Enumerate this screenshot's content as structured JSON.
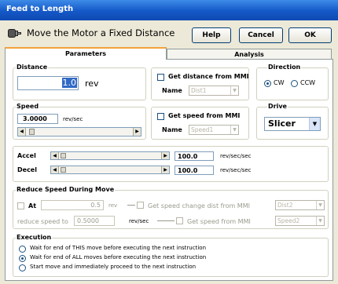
{
  "window": {
    "title": "Feed to Length"
  },
  "header": {
    "title": "Move the Motor a Fixed Distance",
    "help_label": "Help",
    "cancel_label": "Cancel",
    "ok_label": "OK"
  },
  "tabs": [
    {
      "label": "Parameters",
      "selected": true
    },
    {
      "label": "Analysis",
      "selected": false
    }
  ],
  "distance": {
    "label": "Distance",
    "value": "1.0",
    "unit": "rev"
  },
  "mmi_distance": {
    "checkbox_label": "Get distance from MMI",
    "name_label": "Name",
    "name_value": "Dist1"
  },
  "direction": {
    "label": "Direction",
    "options": [
      "CW",
      "CCW"
    ],
    "selected": "CW"
  },
  "speed": {
    "label": "Speed",
    "value": "3.0000",
    "unit": "rev/sec"
  },
  "mmi_speed": {
    "checkbox_label": "Get speed from MMI",
    "name_label": "Name",
    "name_value": "Speed1"
  },
  "drive": {
    "label": "Drive",
    "value": "Slicer"
  },
  "accel": {
    "label": "Accel",
    "value": "100.0",
    "unit": "rev/sec/sec"
  },
  "decel": {
    "label": "Decel",
    "value": "100.0",
    "unit": "rev/sec/sec"
  },
  "reduce": {
    "label": "Reduce Speed During Move",
    "at_label": "At",
    "at_value": "0.5",
    "at_unit": "rev",
    "change_dist_label": "Get speed change dist from MMI",
    "change_dist_value": "Dist2",
    "reduce_to_label": "reduce speed to",
    "reduce_to_value": "0.5000",
    "reduce_to_unit": "rev/sec",
    "speed_mmi_label": "Get speed from MMI",
    "speed_mmi_value": "Speed2"
  },
  "execution": {
    "label": "Execution",
    "options": [
      "Wait for end of THIS move before executing the next instruction",
      "Wait for end of ALL moves before executing the next instruction",
      "Start move and immediately proceed to the next instruction"
    ],
    "selected_index": 1
  },
  "colors": {
    "title_bar": "#1458c7",
    "tab_accent": "#f2a33a",
    "window_bg": "#ece9d8"
  }
}
